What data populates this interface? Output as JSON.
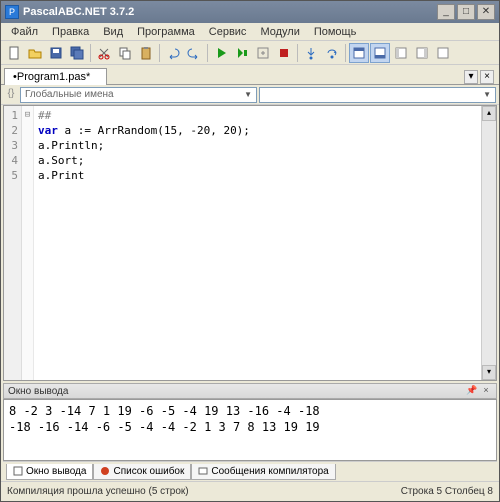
{
  "window": {
    "title": "PascalABC.NET 3.7.2"
  },
  "menu": [
    "Файл",
    "Правка",
    "Вид",
    "Программа",
    "Сервис",
    "Модули",
    "Помощь"
  ],
  "tabs": [
    {
      "label": "•Program1.pas*"
    }
  ],
  "nav": {
    "scope": "Глобальные имена",
    "member": ""
  },
  "editor": {
    "linenums": [
      "1",
      "2",
      "3",
      "4",
      "5"
    ],
    "kwvar": "var",
    "code": [
      "##",
      "a := ArrRandom(15, -20, 20);",
      "a.Println;",
      "a.Sort;",
      "a.Print"
    ]
  },
  "output": {
    "title": "Окно вывода",
    "line1": "8 -2 3 -14 7 1 19 -6 -5 -4 19 13 -16 -4 -18",
    "line2": "-18 -16 -14 -6 -5 -4 -4 -2 1 3 7 8 13 19 19"
  },
  "bottomTabs": [
    "Окно вывода",
    "Список ошибок",
    "Сообщения компилятора"
  ],
  "status": {
    "left": "Компиляция прошла успешно (5 строк)",
    "right": "Строка  5  Столбец  8"
  }
}
